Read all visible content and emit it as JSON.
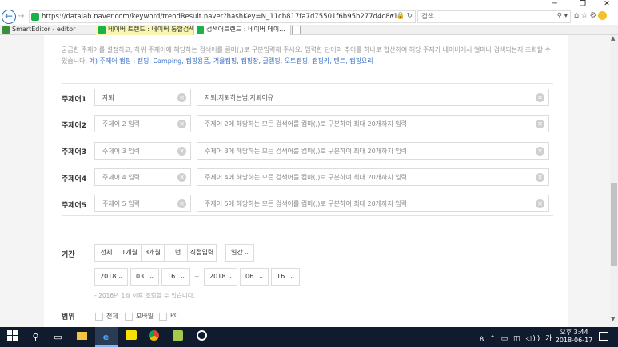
{
  "browser": {
    "url": "https://datalab.naver.com/keyword/trendResult.naver?hashKey=N_11cb817fa7d75501f6b95b277d4c8c1e",
    "search_placeholder": "검색...",
    "tabs": [
      {
        "label": "SmartEditor - editor",
        "icon_color": "#3a8f3a"
      },
      {
        "label": "네이버 트렌드 : 네이버 통합검색",
        "icon_color": "#19b14a"
      },
      {
        "label": "검색어트렌드 : 네이버 데이...",
        "icon_color": "#19b14a"
      }
    ]
  },
  "intro": {
    "text": "궁금한 주제어를 설정하고, 하위 주제어에 해당하는 검색어를 콤마(,)로 구분입력해 주세요. 입력한 단어의 추이를 하나로 합산하여 해당 주제가 네이버에서 얼마나 검색되는지 조회할 수 있습니다.",
    "example": "예) 주제어 캠핑 : 캠핑, Camping, 캠핑용품, 겨울캠핑, 캠핑장, 글램핑, 오토캠핑, 캠핑카, 텐트, 캠핑요리"
  },
  "topics": [
    {
      "label": "주제어1",
      "name": "자퇴",
      "keywords": "자퇴,자퇴하는법,자퇴이유",
      "name_placeholder": false,
      "keywords_placeholder": false
    },
    {
      "label": "주제어2",
      "name": "주제어 2 입력",
      "keywords": "주제어 2에 해당하는 모든 검색어를 컴마(,)로 구분하여 최대 20개까지 입력",
      "name_placeholder": true,
      "keywords_placeholder": true
    },
    {
      "label": "주제어3",
      "name": "주제어 3 입력",
      "keywords": "주제어 3에 해당하는 모든 검색어를 컴마(,)로 구분하여 최대 20개까지 입력",
      "name_placeholder": true,
      "keywords_placeholder": true
    },
    {
      "label": "주제어4",
      "name": "주제어 4 입력",
      "keywords": "주제어 4에 해당하는 모든 검색어를 컴마(,)로 구분하여 최대 20개까지 입력",
      "name_placeholder": true,
      "keywords_placeholder": true
    },
    {
      "label": "주제어5",
      "name": "주제어 5 입력",
      "keywords": "주제어 5에 해당하는 모든 검색어를 컴마(,)로 구분하여 최대 20개까지 입력",
      "name_placeholder": true,
      "keywords_placeholder": true
    }
  ],
  "period": {
    "label": "기간",
    "buttons": [
      "전체",
      "1개월",
      "3개월",
      "1년",
      "직접입력"
    ],
    "interval": "일간",
    "start": {
      "year": "2018",
      "month": "03",
      "day": "16"
    },
    "separator": "~",
    "end": {
      "year": "2018",
      "month": "06",
      "day": "16"
    },
    "note": "- 2016년 1월 이후 조회할 수 있습니다."
  },
  "scope": {
    "label": "범위",
    "options": [
      "전체",
      "모바일",
      "PC"
    ]
  },
  "taskbar": {
    "time": "오후 3:44",
    "date": "2018-06-17"
  }
}
